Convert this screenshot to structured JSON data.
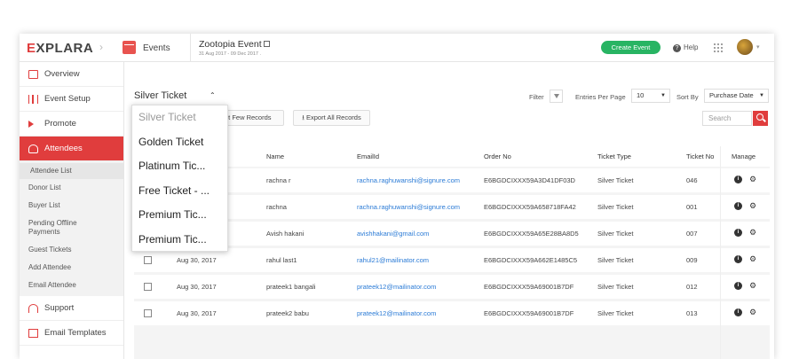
{
  "header": {
    "logo": "XPLARA",
    "logo_mark": "E",
    "section_label": "Events",
    "event_title": "Zootopia Event",
    "event_dates": "31 Aug 2017 - 09 Dec 2017 .",
    "create_button": "Create Event",
    "help_label": "Help"
  },
  "sidebar": {
    "items": [
      {
        "label": "Overview",
        "icon": "monitor-icon"
      },
      {
        "label": "Event Setup",
        "icon": "sliders-icon"
      },
      {
        "label": "Promote",
        "icon": "megaphone-icon"
      },
      {
        "label": "Attendees",
        "icon": "users-icon",
        "active": true
      }
    ],
    "subitems": [
      "Attendee List",
      "Donor List",
      "Buyer List",
      "Pending Offline Payments",
      "Guest Tickets",
      "Add Attendee",
      "Email Attendee"
    ],
    "bottom_items": [
      {
        "label": "Support",
        "icon": "headset-icon"
      },
      {
        "label": "Email Templates",
        "icon": "mail-icon"
      }
    ]
  },
  "toolbar": {
    "ticket_selected": "Silver Ticket",
    "filter_label": "Filter",
    "entries_label": "Entries Per Page",
    "entries_value": "10",
    "sort_label": "Sort By",
    "sort_value": "Purchase Date",
    "import_button": "Import Few Records",
    "export_button": "Export All Records",
    "search_placeholder": "Search"
  },
  "ticket_dropdown": {
    "options": [
      "Silver Ticket",
      "Golden Ticket",
      "Platinum Tic...",
      "Free Ticket - ...",
      "Premium Tic...",
      "Premium Tic..."
    ]
  },
  "table": {
    "headers": {
      "name": "Name",
      "email": "EmailId",
      "order": "Order No",
      "type": "Ticket Type",
      "ticket_no": "Ticket No",
      "manage": "Manage"
    },
    "rows": [
      {
        "date": "",
        "name": "rachna r",
        "email": "rachna.raghuwanshi@signure.com",
        "order": "E6BGDCIXXX59A3D41DF03D",
        "type": "Silver Ticket",
        "ticket_no": "046"
      },
      {
        "date": "",
        "name": "rachna",
        "email": "rachna.raghuwanshi@signure.com",
        "order": "E6BGDCIXXX59A658718FA42",
        "type": "Silver Ticket",
        "ticket_no": "001"
      },
      {
        "date": "",
        "name": "Avish hakani",
        "email": "avishhakani@gmail.com",
        "order": "E6BGDCIXXX59A65E28BA8D5",
        "type": "Silver Ticket",
        "ticket_no": "007"
      },
      {
        "date": "Aug 30, 2017",
        "name": "rahul last1",
        "email": "rahul21@mailinator.com",
        "order": "E6BGDCIXXX59A662E1485C5",
        "type": "Silver Ticket",
        "ticket_no": "009"
      },
      {
        "date": "Aug 30, 2017",
        "name": "prateek1 bangali",
        "email": "prateek12@mailinator.com",
        "order": "E6BGDCIXXX59A69001B7DF",
        "type": "Silver Ticket",
        "ticket_no": "012"
      },
      {
        "date": "Aug 30, 2017",
        "name": "prateek2 babu",
        "email": "prateek12@mailinator.com",
        "order": "E6BGDCIXXX59A69001B7DF",
        "type": "Silver Ticket",
        "ticket_no": "013"
      }
    ]
  },
  "colors": {
    "brand_red": "#e03d3d",
    "create_green": "#28b463",
    "link_blue": "#2b7bd6"
  }
}
